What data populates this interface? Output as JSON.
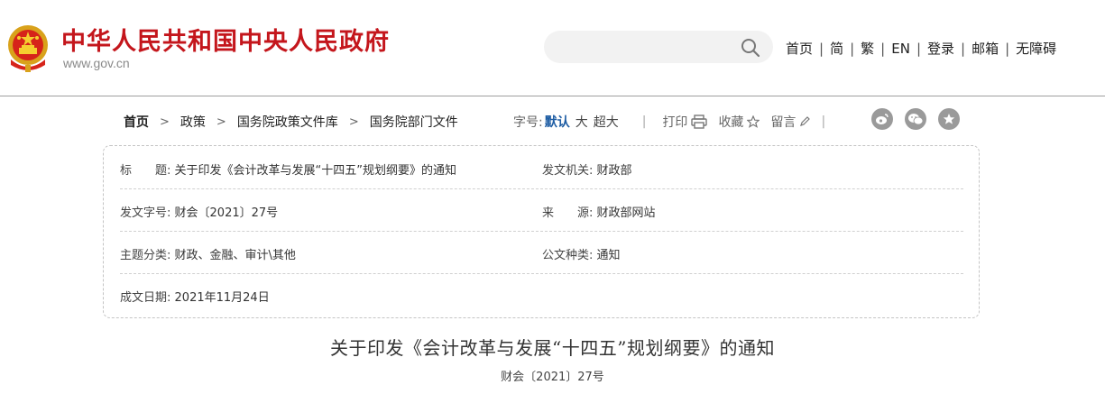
{
  "header": {
    "site_title": "中华人民共和国中央人民政府",
    "domain": "www.gov.cn",
    "search": {
      "value": "",
      "placeholder": ""
    },
    "nav": [
      "首页",
      "简",
      "繁",
      "EN",
      "登录",
      "邮箱",
      "无障碍"
    ]
  },
  "breadcrumb": [
    "首页",
    "政策",
    "国务院政策文件库",
    "国务院部门文件"
  ],
  "toolbar": {
    "font_label": "字号:",
    "font_default": "默认",
    "font_large": "大",
    "font_xlarge": "超大",
    "print": "打印",
    "favorite": "收藏",
    "comment": "留言",
    "separator": "|"
  },
  "info": {
    "title_label": "标　　题:",
    "title_value": "关于印发《会计改革与发展“十四五”规划纲要》的通知",
    "issuer_label": "发文机关:",
    "issuer_value": "财政部",
    "docno_label": "发文字号:",
    "docno_value": "财会〔2021〕27号",
    "source_label": "来　　源:",
    "source_value": "财政部网站",
    "topic_label": "主题分类:",
    "topic_value": "财政、金融、审计\\其他",
    "type_label": "公文种类:",
    "type_value": "通知",
    "date_label": "成文日期:",
    "date_value": "2021年11月24日"
  },
  "document": {
    "title": "关于印发《会计改革与发展“十四五”规划纲要》的通知",
    "number": "财会〔2021〕27号"
  },
  "colors": {
    "brand_red": "#c4161c",
    "active_blue": "#1d5ca3"
  },
  "icons": [
    "national-emblem-icon",
    "search-icon",
    "printer-icon",
    "star-icon",
    "pencil-icon",
    "weibo-icon",
    "wechat-icon",
    "favorite-circle-icon"
  ]
}
